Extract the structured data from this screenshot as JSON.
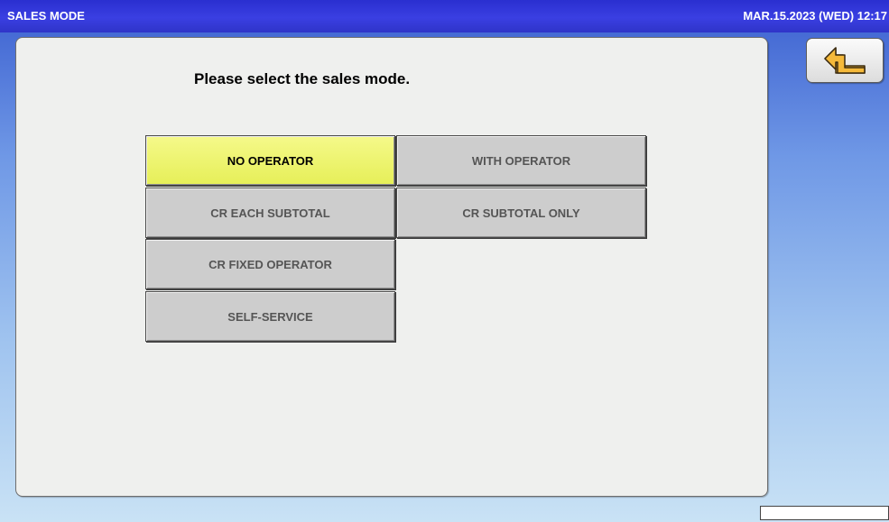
{
  "titlebar": {
    "title": "SALES MODE",
    "datetime": "MAR.15.2023 (WED)  12:17"
  },
  "panel": {
    "prompt": "Please select the sales mode."
  },
  "modes": [
    {
      "label": "NO OPERATOR",
      "selected": true
    },
    {
      "label": "WITH OPERATOR",
      "selected": false
    },
    {
      "label": "CR EACH SUBTOTAL",
      "selected": false
    },
    {
      "label": "CR SUBTOTAL ONLY",
      "selected": false
    },
    {
      "label": "CR FIXED OPERATOR",
      "selected": false
    },
    {
      "label": "SELF-SERVICE",
      "selected": false
    }
  ],
  "icons": {
    "back": "return-arrow-icon"
  },
  "colors": {
    "titlebar": "#2f34d8",
    "selected_button": "#eef36a",
    "button": "#cdcdcd",
    "back_arrow": "#f5b93a"
  }
}
